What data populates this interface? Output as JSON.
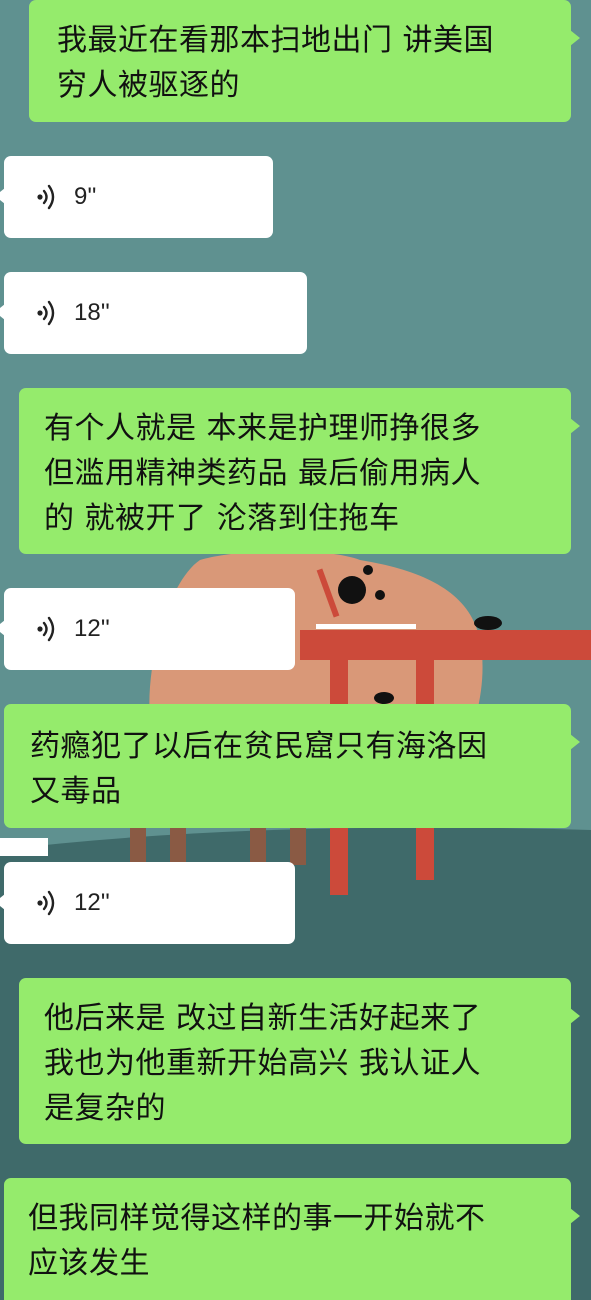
{
  "messages": [
    {
      "type": "text",
      "side": "out",
      "text": "我最近在看那本扫地出门 讲美国\n穷人被驱逐的"
    },
    {
      "type": "voice",
      "side": "in",
      "icon": "voice-wave-icon",
      "duration": "9''"
    },
    {
      "type": "voice",
      "side": "in",
      "icon": "voice-wave-icon",
      "duration": "18''"
    },
    {
      "type": "text",
      "side": "out",
      "text": "有个人就是 本来是护理师挣很多\n但滥用精神类药品 最后偷用病人\n的 就被开了 沦落到住拖车"
    },
    {
      "type": "voice",
      "side": "in",
      "icon": "voice-wave-icon",
      "duration": "12''"
    },
    {
      "type": "text",
      "side": "out",
      "text": "药瘾犯了以后在贫民窟只有海洛因\n又毒品"
    },
    {
      "type": "voice",
      "side": "in",
      "icon": "voice-wave-icon",
      "duration": "12''"
    },
    {
      "type": "text",
      "side": "out",
      "text": "他后来是 改过自新生活好起来了\n我也为他重新开始高兴 我认证人\n是复杂的"
    },
    {
      "type": "text",
      "side": "out",
      "text": "但我同样觉得这样的事一开始就不\n应该发生"
    }
  ],
  "colors": {
    "wallpaper": "#5f9190",
    "bubble_out": "#95eb6c",
    "bubble_in": "#ffffff",
    "table": "#cc4a3a",
    "figure": "#d99878"
  }
}
